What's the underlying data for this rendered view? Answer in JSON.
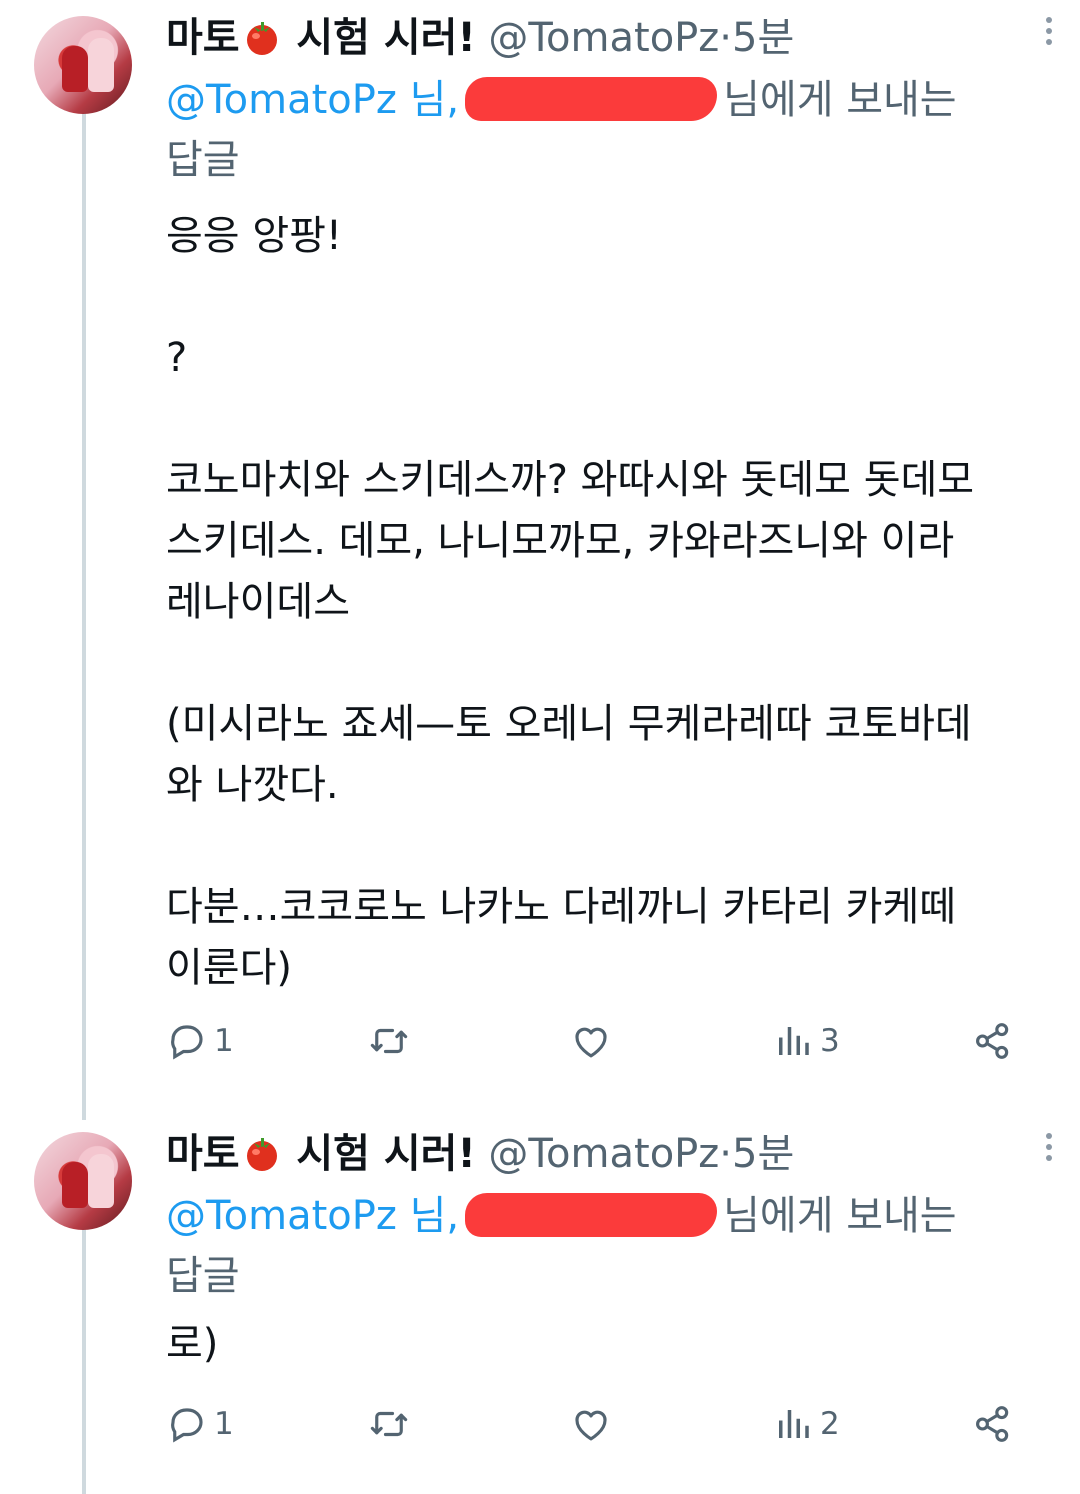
{
  "tweets": [
    {
      "display_name": "마토",
      "display_name_suffix": "시험 시러!",
      "handle": "@TomatoPz",
      "separator": "·",
      "time": "5분",
      "reply_mention": "@TomatoPz 님,",
      "reply_suffix": "님에게 보내는",
      "reply_line2": "답글",
      "text": "응응 앙팡!\n\n?\n\n코노마치와 스키데스까? 와따시와 돗데모 돗데모\n스키데스. 데모, 나니모까모, 카와라즈니와 이라\n레나이데스\n\n(미시라노 죠세—토 오레니 무케라레따 코토바데\n와 나깟다.\n\n다분…코코로노 나카노 다레까니 카타리 카케떼\n이룬다)",
      "reply_count": "1",
      "retweet_count": "",
      "like_count": "",
      "views_count": "3"
    },
    {
      "display_name": "마토",
      "display_name_suffix": "시험 시러!",
      "handle": "@TomatoPz",
      "separator": "·",
      "time": "5분",
      "reply_mention": "@TomatoPz 님,",
      "reply_suffix": "님에게 보내는",
      "reply_line2": "답글",
      "text": "로)",
      "reply_count": "1",
      "retweet_count": "",
      "like_count": "",
      "views_count": "2"
    }
  ],
  "icons": {
    "reply": "reply-icon",
    "retweet": "retweet-icon",
    "like": "heart-icon",
    "views": "views-icon",
    "share": "share-icon",
    "more": "more-icon",
    "emoji": "tomato-emoji"
  },
  "colors": {
    "link": "#1d9bf0",
    "secondary": "#536471",
    "thread_line": "#cfd9de",
    "redaction": "#fb3b3b"
  }
}
